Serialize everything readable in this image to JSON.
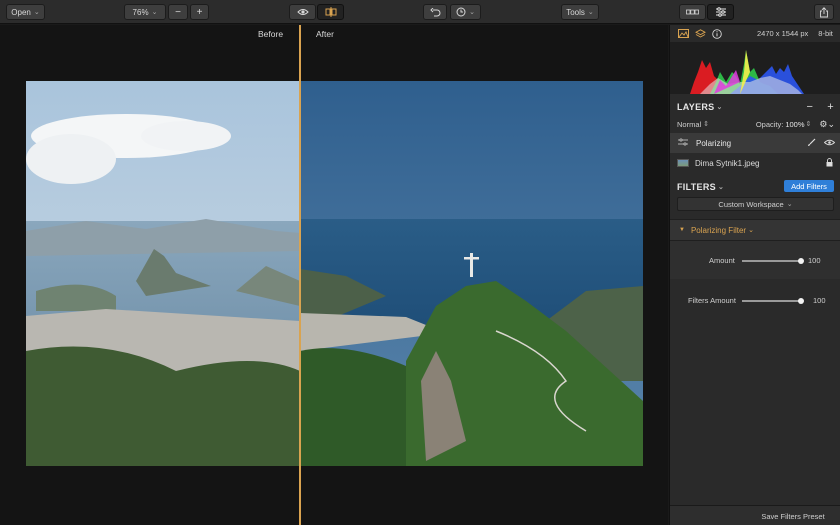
{
  "toolbar": {
    "open_label": "Open",
    "zoom_value": "76%",
    "zoom_out_label": "−",
    "zoom_in_label": "+",
    "tools_label": "Tools"
  },
  "canvas": {
    "before_label": "Before",
    "after_label": "After",
    "split_position": 0.444
  },
  "panel": {
    "image_info": "2470 x 1544 px",
    "bit_depth": "8-bit",
    "layers": {
      "title": "LAYERS",
      "blend_mode": "Normal",
      "opacity_label": "Opacity:",
      "opacity_value": "100%",
      "items": [
        {
          "name": "Polarizing",
          "type": "filter-layer"
        },
        {
          "name": "Dima Sytnik1.jpeg",
          "type": "image-layer"
        }
      ]
    },
    "filters": {
      "title": "FILTERS",
      "add_button": "Add Filters",
      "workspace": "Custom Workspace",
      "filter_name": "Polarizing Filter",
      "amount_label": "Amount",
      "amount_value": "100",
      "filters_amount_label": "Filters Amount",
      "filters_amount_value": "100"
    },
    "save_preset": "Save Filters Preset"
  },
  "colors": {
    "accent": "#d9a350",
    "blue_button": "#2f7fd8"
  }
}
